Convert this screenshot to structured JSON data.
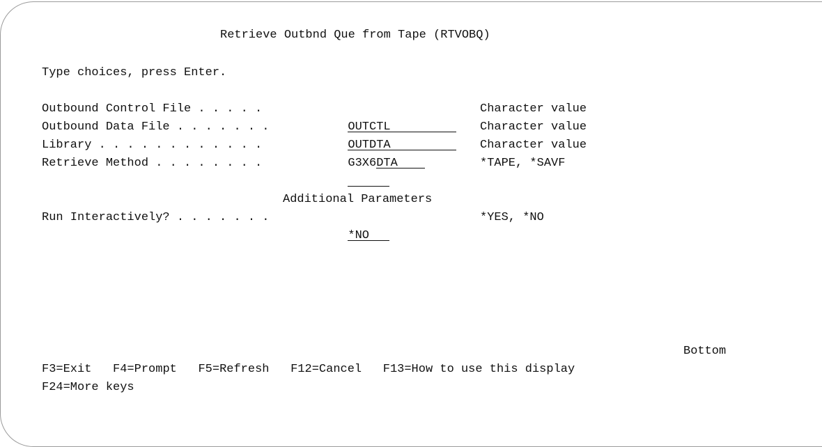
{
  "screen": {
    "title": "Retrieve Outbnd Que from Tape (RTVOBQ)",
    "instructions": "Type choices, press Enter.",
    "section_heading": "Additional Parameters",
    "more_indicator": "Bottom"
  },
  "fields": [
    {
      "label": "Outbound Control File . . . . .",
      "prefix": "",
      "value": "OUTCTL",
      "hint": "Character value"
    },
    {
      "label": "Outbound Data File . . . . . . .",
      "prefix": "",
      "value": "OUTDTA",
      "hint": "Character value"
    },
    {
      "label": "Library . . . . . . . . . . . .",
      "prefix": "G3X6",
      "value": "DTA",
      "hint": "Character value"
    },
    {
      "label": "Retrieve Method . . . . . . . .",
      "prefix": "",
      "value": "",
      "hint": "*TAPE, *SAVF"
    }
  ],
  "additional_fields": [
    {
      "label": "Run Interactively? . . . . . . .",
      "prefix": "",
      "value": "*NO",
      "hint": "*YES, *NO"
    }
  ],
  "function_keys": {
    "row1": [
      "F3=Exit",
      "F4=Prompt",
      "F5=Refresh",
      "F12=Cancel",
      "F13=How to use this display"
    ],
    "row2": [
      "F24=More keys"
    ]
  }
}
